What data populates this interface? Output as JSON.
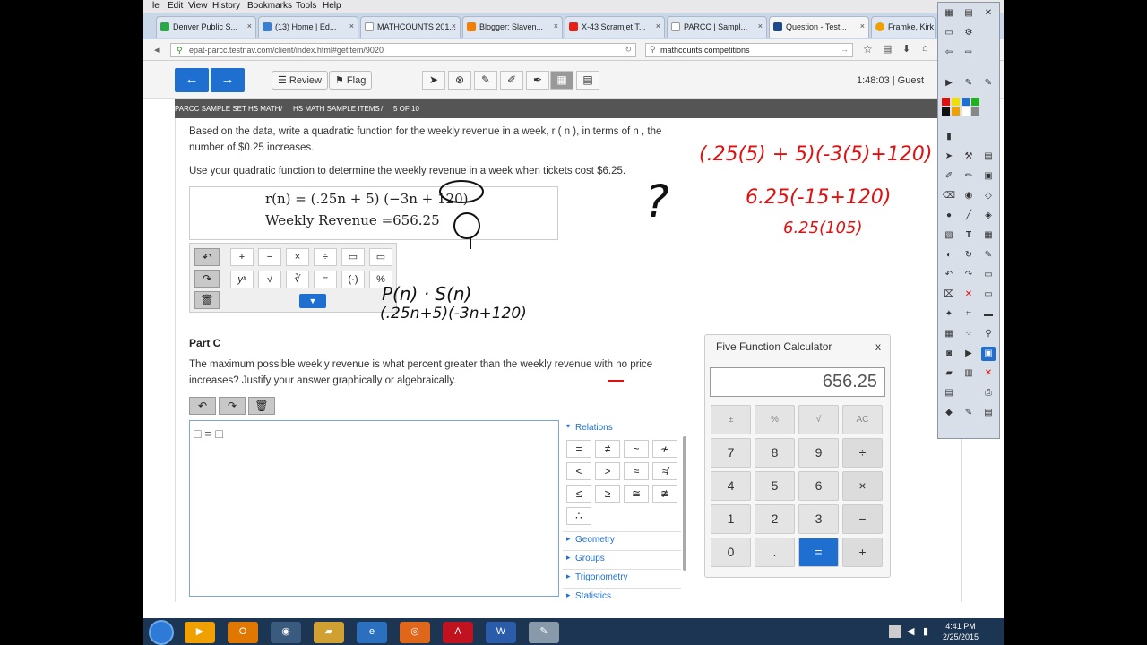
{
  "menubar": {
    "items": [
      "le",
      "Edit",
      "View",
      "History",
      "Bookmarks",
      "Tools",
      "Help"
    ]
  },
  "tabs": [
    {
      "label": "Denver Public S...",
      "color": "#2aa748"
    },
    {
      "label": "(13) Home | Ed...",
      "color": "#3b7fd4"
    },
    {
      "label": "MATHCOUNTS 201...",
      "color": "#ffffff"
    },
    {
      "label": "Blogger: Slaven...",
      "color": "#f57d00"
    },
    {
      "label": "X-43 Scramjet T...",
      "color": "#e62117"
    },
    {
      "label": "PARCC | Sampl...",
      "color": "#ffffff"
    },
    {
      "label": "Question - Test...",
      "color": "#1c4a8c"
    },
    {
      "label": "Framke, Kirk -...",
      "color": "#f0a000"
    }
  ],
  "browser": {
    "url": "epat-parcc.testnav.com/client/index.html#getitem/9020",
    "search": "mathcounts competitions"
  },
  "toolbar": {
    "prev": "←",
    "next": "→",
    "review": "Review",
    "flag": "Flag",
    "timer": "1:48:03 | Guest"
  },
  "breadcrumb": {
    "set": "PARCC SAMPLE SET HS MATH",
    "items": "HS MATH SAMPLE ITEMS",
    "position": "5 OF 10",
    "sep": "/"
  },
  "question": {
    "line1": "Based on the data, write a quadratic function for the weekly revenue in a week, r ( n ), in terms of n , the",
    "line2": "number of $0.25 increases.",
    "line3": "Use your quadratic function to determine the weekly revenue in a week when tickets cost $6.25.",
    "answer_line1": "r(n) = (.25n + 5) (−3n + 120)",
    "answer_line2": "Weekly Revenue =656.25"
  },
  "mathpad": {
    "row1": [
      "+",
      "−",
      "×",
      "÷",
      "▭",
      "▭"
    ],
    "row2": [
      "yˣ",
      "√",
      "∛",
      "=",
      "(·)",
      "%"
    ]
  },
  "partc": {
    "title": "Part C",
    "text1": "The maximum possible weekly revenue is what percent greater than the weekly revenue with no price",
    "text2": "increases? Justify your answer graphically or algebraically.",
    "editor_content": "□ = □"
  },
  "symbols": {
    "relations_label": "Relations",
    "relations": [
      "=",
      "≠",
      "~",
      "≁",
      "<",
      ">",
      "≈",
      "≉",
      "≤",
      "≥",
      "≅",
      "≇",
      "∴"
    ],
    "categories": [
      "Geometry",
      "Groups",
      "Trigonometry",
      "Statistics"
    ]
  },
  "calculator": {
    "title": "Five Function Calculator",
    "close": "x",
    "display": "656.25",
    "keys": [
      "±",
      "%",
      "√",
      "AC",
      "7",
      "8",
      "9",
      "÷",
      "4",
      "5",
      "6",
      "×",
      "1",
      "2",
      "3",
      "−",
      "0",
      ".",
      "=",
      "+"
    ]
  },
  "annotations": {
    "red_line1": "(.25(5) + 5)(-3(5)+120)",
    "red_line2": "6.25(-15+120)",
    "red_line3": "6.25(105)",
    "black_line1": "P(n) · S(n)",
    "black_line2": "(.25n+5)(-3n+120)",
    "question_mark": "?"
  },
  "clock": {
    "time": "4:41 PM",
    "date": "2/25/2015"
  },
  "colors": {
    "accent": "#1f6fd1",
    "ink_red": "#e01010",
    "taskbar": "#1c3552"
  }
}
